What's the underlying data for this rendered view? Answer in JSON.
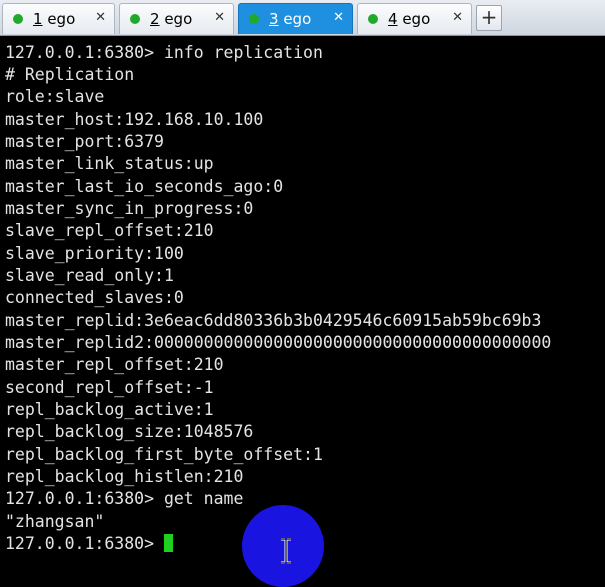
{
  "tabs": [
    {
      "number": "1",
      "name": " ego",
      "status_color": "#1faa2c"
    },
    {
      "number": "2",
      "name": " ego",
      "status_color": "#1faa2c"
    },
    {
      "number": "3",
      "name": " ego",
      "status_color": "#1faa2c",
      "active": true
    },
    {
      "number": "4",
      "name": " ego",
      "status_color": "#1faa2c"
    }
  ],
  "close_glyph": "✕",
  "add_tab_glyph": "+",
  "terminal": {
    "lines": [
      "127.0.0.1:6380> info replication",
      "# Replication",
      "role:slave",
      "master_host:192.168.10.100",
      "master_port:6379",
      "master_link_status:up",
      "master_last_io_seconds_ago:0",
      "master_sync_in_progress:0",
      "slave_repl_offset:210",
      "slave_priority:100",
      "slave_read_only:1",
      "connected_slaves:0",
      "master_replid:3e6eac6dd80336b3b0429546c60915ab59bc69b3",
      "master_replid2:0000000000000000000000000000000000000000",
      "master_repl_offset:210",
      "second_repl_offset:-1",
      "repl_backlog_active:1",
      "repl_backlog_size:1048576",
      "repl_backlog_first_byte_offset:1",
      "repl_backlog_histlen:210",
      "127.0.0.1:6380> get name",
      "\"zhangsan\""
    ],
    "prompt": "127.0.0.1:6380> ",
    "cursor_color": "#1fd11f",
    "text_color": "#e4e4e4",
    "background": "#000000"
  },
  "colors": {
    "active_tab": "#1f8fe0",
    "pointer_highlight": "#1a14e0"
  }
}
